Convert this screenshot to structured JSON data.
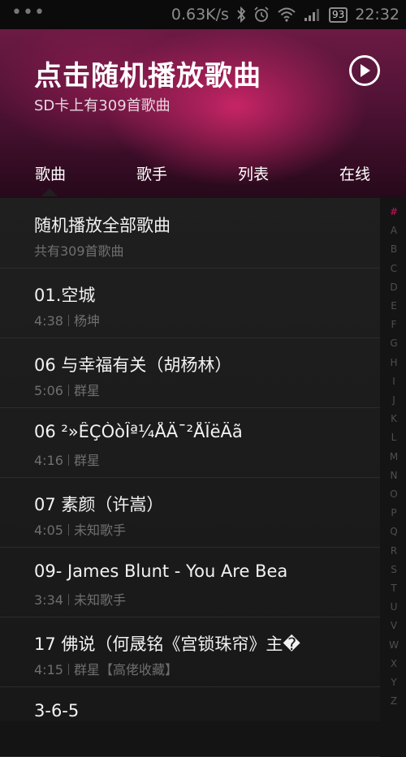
{
  "status": {
    "speed": "0.63K/s",
    "battery": "93",
    "time": "22:32"
  },
  "header": {
    "title": "点击随机播放歌曲",
    "subtitle": "SD卡上有309首歌曲",
    "tabs": [
      "歌曲",
      "歌手",
      "列表",
      "在线"
    ],
    "active_tab": "歌曲"
  },
  "shuffle": {
    "title": "随机播放全部歌曲",
    "subtitle": "共有309首歌曲"
  },
  "songs": [
    {
      "title": "01.空城",
      "duration": "4:38",
      "artist": "杨坤"
    },
    {
      "title": "06 与幸福有关（胡杨林）",
      "duration": "5:06",
      "artist": "群星"
    },
    {
      "title": "06 ²»ÊÇÒòÎª¼ÅÄ¯²ÅÏëÄã",
      "duration": "4:16",
      "artist": "群星"
    },
    {
      "title": "07 素颜（许嵩）",
      "duration": "4:05",
      "artist": "未知歌手"
    },
    {
      "title": "09- James Blunt - You Are Bea",
      "duration": "3:34",
      "artist": "未知歌手"
    },
    {
      "title": "17 佛说（何晟铭《宫锁珠帘》主�",
      "duration": "4:15",
      "artist": "群星【高佬收藏】"
    },
    {
      "title": "3-6-5",
      "duration": "",
      "artist": ""
    }
  ],
  "alphabet": [
    "#",
    "A",
    "B",
    "C",
    "D",
    "E",
    "F",
    "G",
    "H",
    "I",
    "J",
    "K",
    "L",
    "M",
    "N",
    "O",
    "P",
    "Q",
    "R",
    "S",
    "T",
    "U",
    "V",
    "W",
    "X",
    "Y",
    "Z"
  ],
  "colors": {
    "accent": "#c8185f",
    "header_dark": "#4f1235",
    "list_bg": "#1c1c1c",
    "alpha_active": "#c8185f"
  }
}
